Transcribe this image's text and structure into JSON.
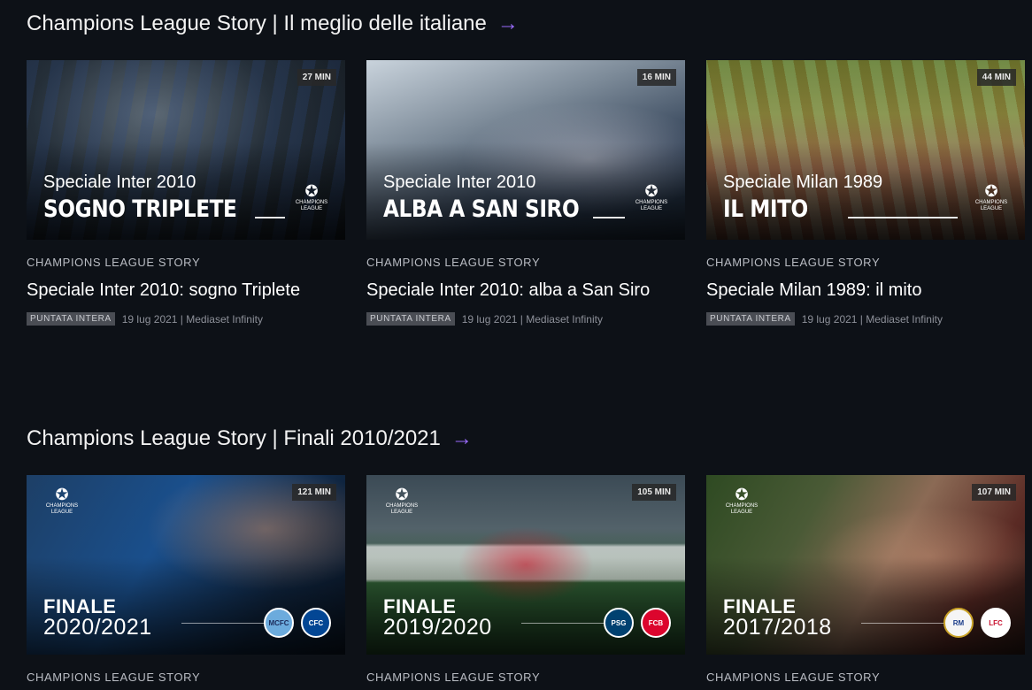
{
  "sections": [
    {
      "title": "Champions League Story | Il meglio delle italiane",
      "arrow": "→",
      "cards": [
        {
          "duration": "27 MIN",
          "overlay_sub": "Speciale Inter 2010",
          "overlay_title": "SOGNO TRIPLETE",
          "logo_text": "CHAMPIONS LEAGUE",
          "series": "CHAMPIONS LEAGUE STORY",
          "title": "Speciale Inter 2010: sogno Triplete",
          "tag": "PUNTATA INTERA",
          "info": "19 lug 2021 | Mediaset Infinity",
          "bg": "#1f2a33"
        },
        {
          "duration": "16 MIN",
          "overlay_sub": "Speciale Inter 2010",
          "overlay_title": "ALBA A SAN SIRO",
          "logo_text": "CHAMPIONS LEAGUE",
          "series": "CHAMPIONS LEAGUE STORY",
          "title": "Speciale Inter 2010: alba a San Siro",
          "tag": "PUNTATA INTERA",
          "info": "19 lug 2021 | Mediaset Infinity",
          "bg": "#3a4a5c"
        },
        {
          "duration": "44 MIN",
          "overlay_sub": "Speciale Milan 1989",
          "overlay_title": "IL MITO",
          "logo_text": "CHAMPIONS LEAGUE",
          "series": "CHAMPIONS LEAGUE STORY",
          "title": "Speciale Milan 1989: il mito",
          "tag": "PUNTATA INTERA",
          "info": "19 lug 2021 | Mediaset Infinity",
          "bg": "#4a5a2a"
        }
      ]
    },
    {
      "title": "Champions League Story | Finali 2010/2021",
      "arrow": "→",
      "cards": [
        {
          "duration": "121 MIN",
          "label": "FINALE",
          "year": "2020/2021",
          "logo_text": "CHAMPIONS LEAGUE",
          "crest1": "MCFC",
          "crest2": "CFC",
          "series": "CHAMPIONS LEAGUE STORY",
          "bg": "#14304d"
        },
        {
          "duration": "105 MIN",
          "label": "FINALE",
          "year": "2019/2020",
          "logo_text": "CHAMPIONS LEAGUE",
          "crest1": "PSG",
          "crest2": "FCB",
          "series": "CHAMPIONS LEAGUE STORY",
          "bg": "#2c4a2c"
        },
        {
          "duration": "107 MIN",
          "label": "FINALE",
          "year": "2017/2018",
          "logo_text": "CHAMPIONS LEAGUE",
          "crest1": "RM",
          "crest2": "LFC",
          "series": "CHAMPIONS LEAGUE STORY",
          "bg": "#3a3a2a"
        }
      ]
    }
  ]
}
